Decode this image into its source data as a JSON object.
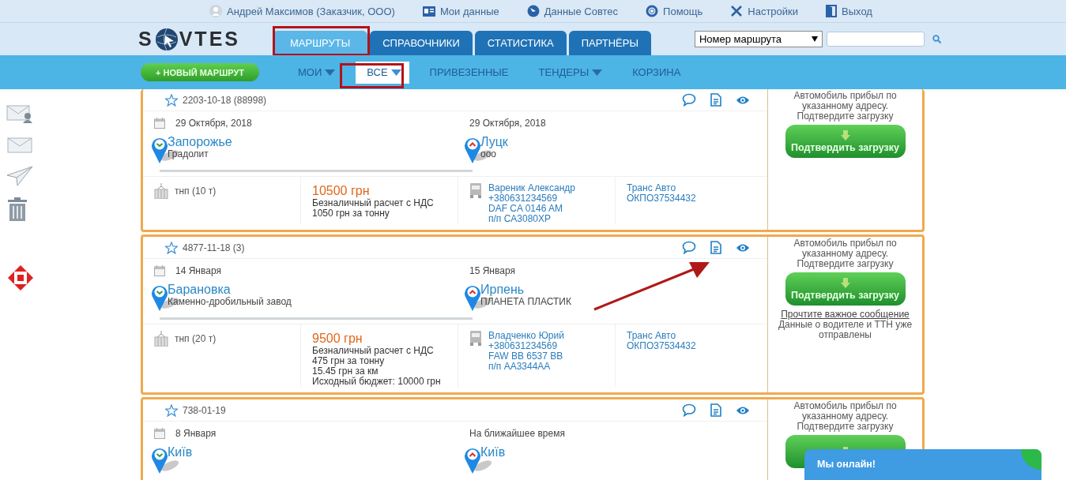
{
  "top_bar": {
    "user": "Андрей Максимов (Заказчик, ООО)",
    "links": [
      {
        "label": "Мои данные",
        "kind": "profile"
      },
      {
        "label": "Данные Совтес",
        "kind": "info"
      },
      {
        "label": "Помощь",
        "kind": "help"
      },
      {
        "label": "Настройки",
        "kind": "settings"
      },
      {
        "label": "Выход",
        "kind": "exit"
      }
    ]
  },
  "logo": {
    "left": "S",
    "right": "VTES"
  },
  "main_tabs": [
    {
      "label": "МАРШРУТЫ",
      "selected": true
    },
    {
      "label": "СПРАВОЧНИКИ",
      "selected": false
    },
    {
      "label": "СТАТИСТИКА",
      "selected": false
    },
    {
      "label": "ПАРТНЁРЫ",
      "selected": false
    }
  ],
  "search": {
    "select": "Номер маршрута"
  },
  "new_route_button": "+ НОВЫЙ МАРШРУТ",
  "sub_tabs": [
    {
      "label": "МОИ",
      "dropdown": true,
      "selected": false
    },
    {
      "label": "ВСЕ",
      "dropdown": true,
      "selected": true
    },
    {
      "label": "ПРИВЕЗЕННЫЕ",
      "dropdown": false,
      "selected": false
    },
    {
      "label": "ТЕНДЕРЫ",
      "dropdown": true,
      "selected": false
    },
    {
      "label": "КОРЗИНА",
      "dropdown": false,
      "selected": false
    }
  ],
  "routes": [
    {
      "id": "2203-10-18 (88998)",
      "starred": false,
      "load_date": "29 Октября, 2018",
      "unload_date": "29 Октября, 2018",
      "origin": {
        "city": "Запорожье",
        "company": "Градолит"
      },
      "destination": {
        "city": "Луцк",
        "company": "ооо"
      },
      "cargo": "тнп (10 т)",
      "price": "10500 грн",
      "payment_lines": [
        "Безналичный расчет с НДС",
        "1050 грн за тонну"
      ],
      "driver_lines": [
        "Вареник Александр",
        "+380631234569",
        "DAF CA 0146 AM",
        "п/п CA3080XP"
      ],
      "carrier_lines": [
        "Транс Авто",
        "ОКПО37534432"
      ],
      "status": "Автомобиль прибыл по указанному адресу. Подтвердите загрузку",
      "button_label": "Подтвердить загрузку"
    },
    {
      "id": "4877-11-18 (3)",
      "starred": false,
      "load_date": "14 Января",
      "unload_date": "15 Января",
      "origin": {
        "city": "Барановка",
        "company": "Каменно-дробильный завод"
      },
      "destination": {
        "city": "Ирпень",
        "company": "ПЛАНЕТА ПЛАСТИК"
      },
      "cargo": "тнп (20 т)",
      "price": "9500 грн",
      "payment_lines": [
        "Безналичный расчет с НДС",
        "475 грн за тонну",
        "15.45 грн за км",
        "Исходный бюджет: 10000 грн"
      ],
      "driver_lines": [
        "Владченко Юрий",
        "+380631234569",
        "FAW BB 6537 BB",
        "п/п AA3344AA"
      ],
      "carrier_lines": [
        "Транс Авто",
        "ОКПО37534432"
      ],
      "status": "Автомобиль прибыл по указанному адресу. Подтвердите загрузку",
      "button_label": "Подтвердить загрузку",
      "notice_link": "Прочтите важное сообщение",
      "notice": "Данные о водителе и ТТН уже отправлены"
    },
    {
      "id": "738-01-19",
      "starred": false,
      "load_date": "8 Января",
      "unload_date": "На ближайшее время",
      "origin": {
        "city": "Київ"
      },
      "destination": {
        "city": "Київ"
      },
      "status": "Автомобиль прибыл по указанному адресу. Подтвердите загрузку"
    }
  ],
  "chat": {
    "label": "Мы онлайн!"
  }
}
